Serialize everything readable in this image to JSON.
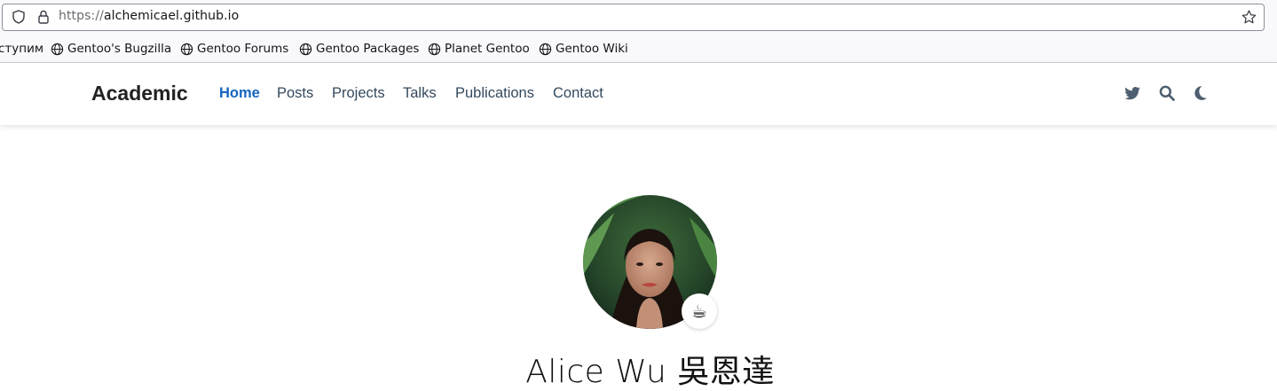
{
  "browser": {
    "url_scheme": "https://",
    "url_host": "alchemicael.github.io",
    "bookmarks": [
      {
        "label": "ступим"
      },
      {
        "label": "Gentoo's Bugzilla"
      },
      {
        "label": "Gentoo Forums"
      },
      {
        "label": "Gentoo Packages"
      },
      {
        "label": "Planet Gentoo"
      },
      {
        "label": "Gentoo Wiki"
      }
    ]
  },
  "navbar": {
    "brand": "Academic",
    "items": [
      {
        "label": "Home",
        "active": true
      },
      {
        "label": "Posts"
      },
      {
        "label": "Projects"
      },
      {
        "label": "Talks"
      },
      {
        "label": "Publications"
      },
      {
        "label": "Contact"
      }
    ],
    "icons": [
      "twitter-icon",
      "search-icon",
      "moon-icon"
    ]
  },
  "hero": {
    "status_emoji": "☕",
    "name": "Alice Wu 吳恩達"
  },
  "colors": {
    "accent": "#1565c0",
    "nav_text": "#34495e",
    "icon": "#4d5f70"
  }
}
